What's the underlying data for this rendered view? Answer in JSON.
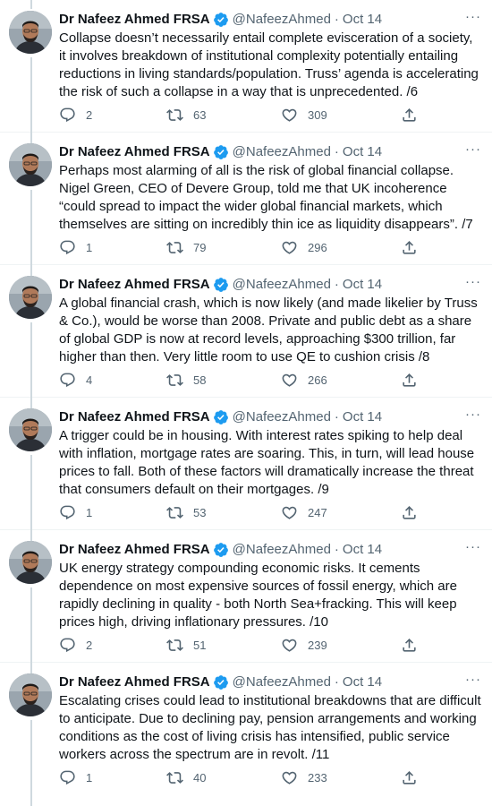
{
  "author": {
    "name": "Dr Nafeez Ahmed FRSA",
    "handle": "@NafeezAhmed",
    "separator": "·"
  },
  "more_label": "···",
  "colors": {
    "verified": "#1d9bf0",
    "secondary_text": "#536471",
    "thread_line": "#cfd9de"
  },
  "icons": {
    "reply": "reply-icon",
    "retweet": "retweet-icon",
    "like": "like-icon",
    "share": "share-icon",
    "verified": "verified-badge-icon",
    "more": "more-icon"
  },
  "tweets": [
    {
      "date": "Oct 14",
      "text": "Collapse doesn’t necessarily entail complete evisceration of a society, it involves breakdown of institutional complexity potentially entailing reductions in living standards/population. Truss’ agenda is accelerating the risk of such a collapse in a way that is unprecedented. /6",
      "replies": "2",
      "retweets": "63",
      "likes": "309"
    },
    {
      "date": "Oct 14",
      "text": "Perhaps most alarming of all is the risk of global financial collapse. Nigel Green, CEO of Devere Group, told me that UK incoherence “could spread to impact the wider global financial markets, which themselves are sitting on incredibly thin ice as liquidity disappears”. /7",
      "replies": "1",
      "retweets": "79",
      "likes": "296"
    },
    {
      "date": "Oct 14",
      "text": "A global financial crash, which is now likely (and made likelier by Truss & Co.), would be worse than 2008. Private and public debt as a share of global GDP is now at record levels, approaching $300 trillion, far higher than then. Very little room to use QE to cushion crisis /8",
      "replies": "4",
      "retweets": "58",
      "likes": "266"
    },
    {
      "date": "Oct 14",
      "text": "A trigger could be in housing. With interest rates spiking to help deal with inflation, mortgage rates are soaring. This, in turn, will lead house prices to fall. Both of these factors will dramatically increase the threat that consumers default on their mortgages. /9",
      "replies": "1",
      "retweets": "53",
      "likes": "247"
    },
    {
      "date": "Oct 14",
      "text": "UK energy strategy compounding economic risks. It cements dependence on most expensive sources of fossil energy, which are rapidly declining in quality - both North Sea+fracking. This will keep prices high, driving inflationary pressures. /10",
      "replies": "2",
      "retweets": "51",
      "likes": "239"
    },
    {
      "date": "Oct 14",
      "text": "Escalating crises could lead to institutional breakdowns that are difficult to anticipate. Due to declining pay, pension arrangements and working conditions as the cost of living crisis has intensified, public service workers across the spectrum are in revolt. /11",
      "replies": "1",
      "retweets": "40",
      "likes": "233"
    }
  ]
}
